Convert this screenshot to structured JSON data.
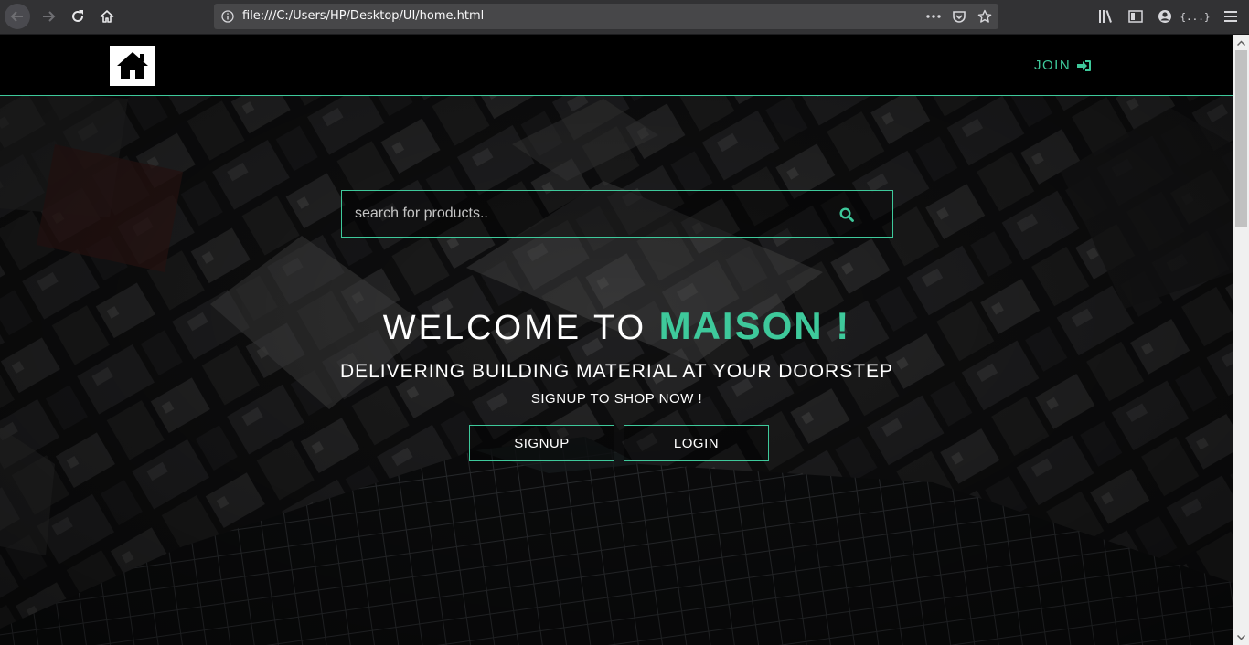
{
  "browser": {
    "url": "file:///C:/Users/HP/Desktop/UI/home.html",
    "reader_text": "{...}"
  },
  "header": {
    "logo_icon": "house-icon",
    "join_label": "JOIN",
    "join_icon": "sign-in-icon"
  },
  "search": {
    "placeholder": "search for products..",
    "icon": "search-icon"
  },
  "hero": {
    "welcome_prefix": "WELCOME TO ",
    "brand_name": "MAISON !",
    "tagline": "DELIVERING BUILDING MATERIAL AT YOUR DOORSTEP",
    "cta_text": "SIGNUP TO SHOP NOW !",
    "signup_label": "SIGNUP",
    "login_label": "LOGIN"
  },
  "colors": {
    "accent": "#3ec99b",
    "header_bg": "#000000",
    "browser_chrome": "#323234"
  }
}
